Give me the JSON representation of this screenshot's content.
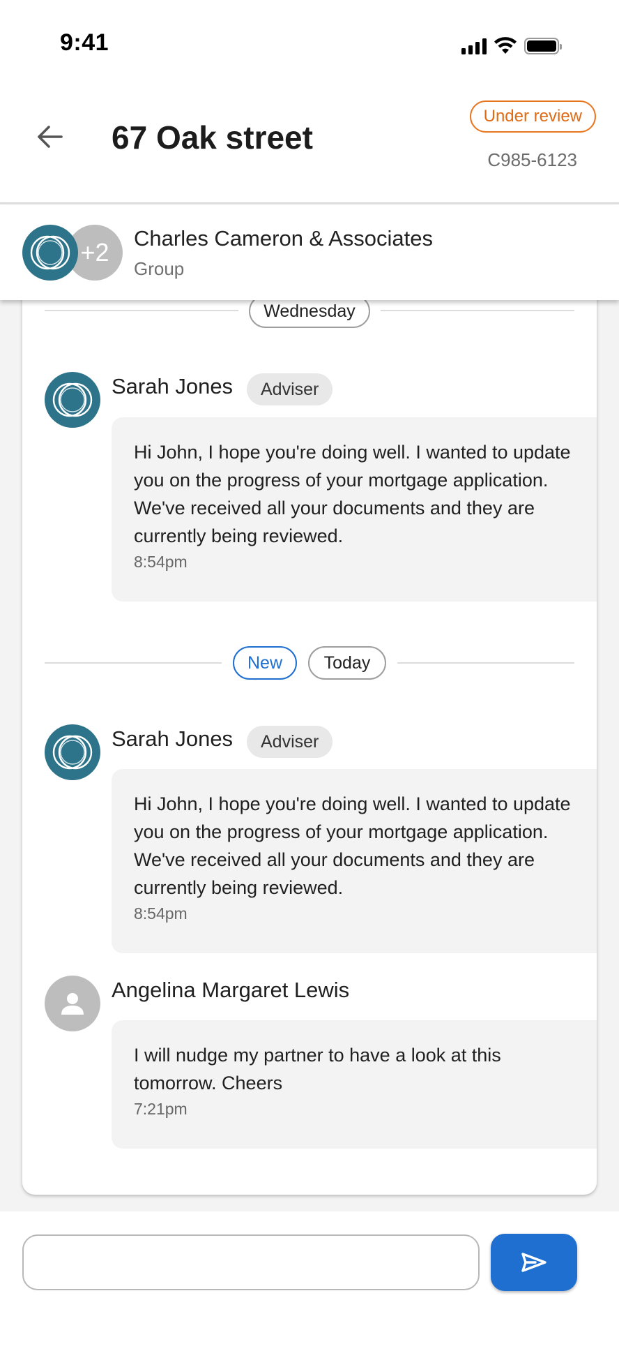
{
  "status_bar": {
    "time": "9:41",
    "icons": [
      "cellular-signal-icon",
      "wifi-icon",
      "battery-icon"
    ]
  },
  "header": {
    "title": "67 Oak street",
    "status_badge": "Under review",
    "reference": "C985-6123",
    "back_icon": "arrow-left-icon",
    "colors": {
      "status": "#e87722"
    }
  },
  "group": {
    "name": "Charles Cameron & Associates",
    "type": "Group",
    "extra_members": "+2"
  },
  "chat": {
    "sections": [
      {
        "day_label": "Wednesday"
      },
      {
        "new_label": "New",
        "day_label": "Today"
      }
    ],
    "messages": [
      {
        "sender": "Sarah Jones",
        "role": "Adviser",
        "text": "Hi John, I hope you're doing well. I wanted to update you on the progress of your mortgage application. We've received all your documents and they are currently being reviewed.",
        "time": "8:54pm"
      },
      {
        "sender": "Sarah Jones",
        "role": "Adviser",
        "text": "Hi John, I hope you're doing well. I wanted to update you on the progress of your mortgage application. We've received all your documents and they are currently being reviewed.",
        "time": "8:54pm"
      },
      {
        "sender": "Angelina Margaret Lewis",
        "role": "",
        "text": "I will nudge my partner to have a look at this tomorrow. Cheers",
        "time": "7:21pm"
      }
    ]
  },
  "composer": {
    "placeholder": "",
    "send_icon": "send-icon",
    "colors": {
      "accent": "#1f6fd1"
    }
  },
  "colors": {
    "brand": "#2d7389",
    "new_marker": "#1e6fd0"
  }
}
